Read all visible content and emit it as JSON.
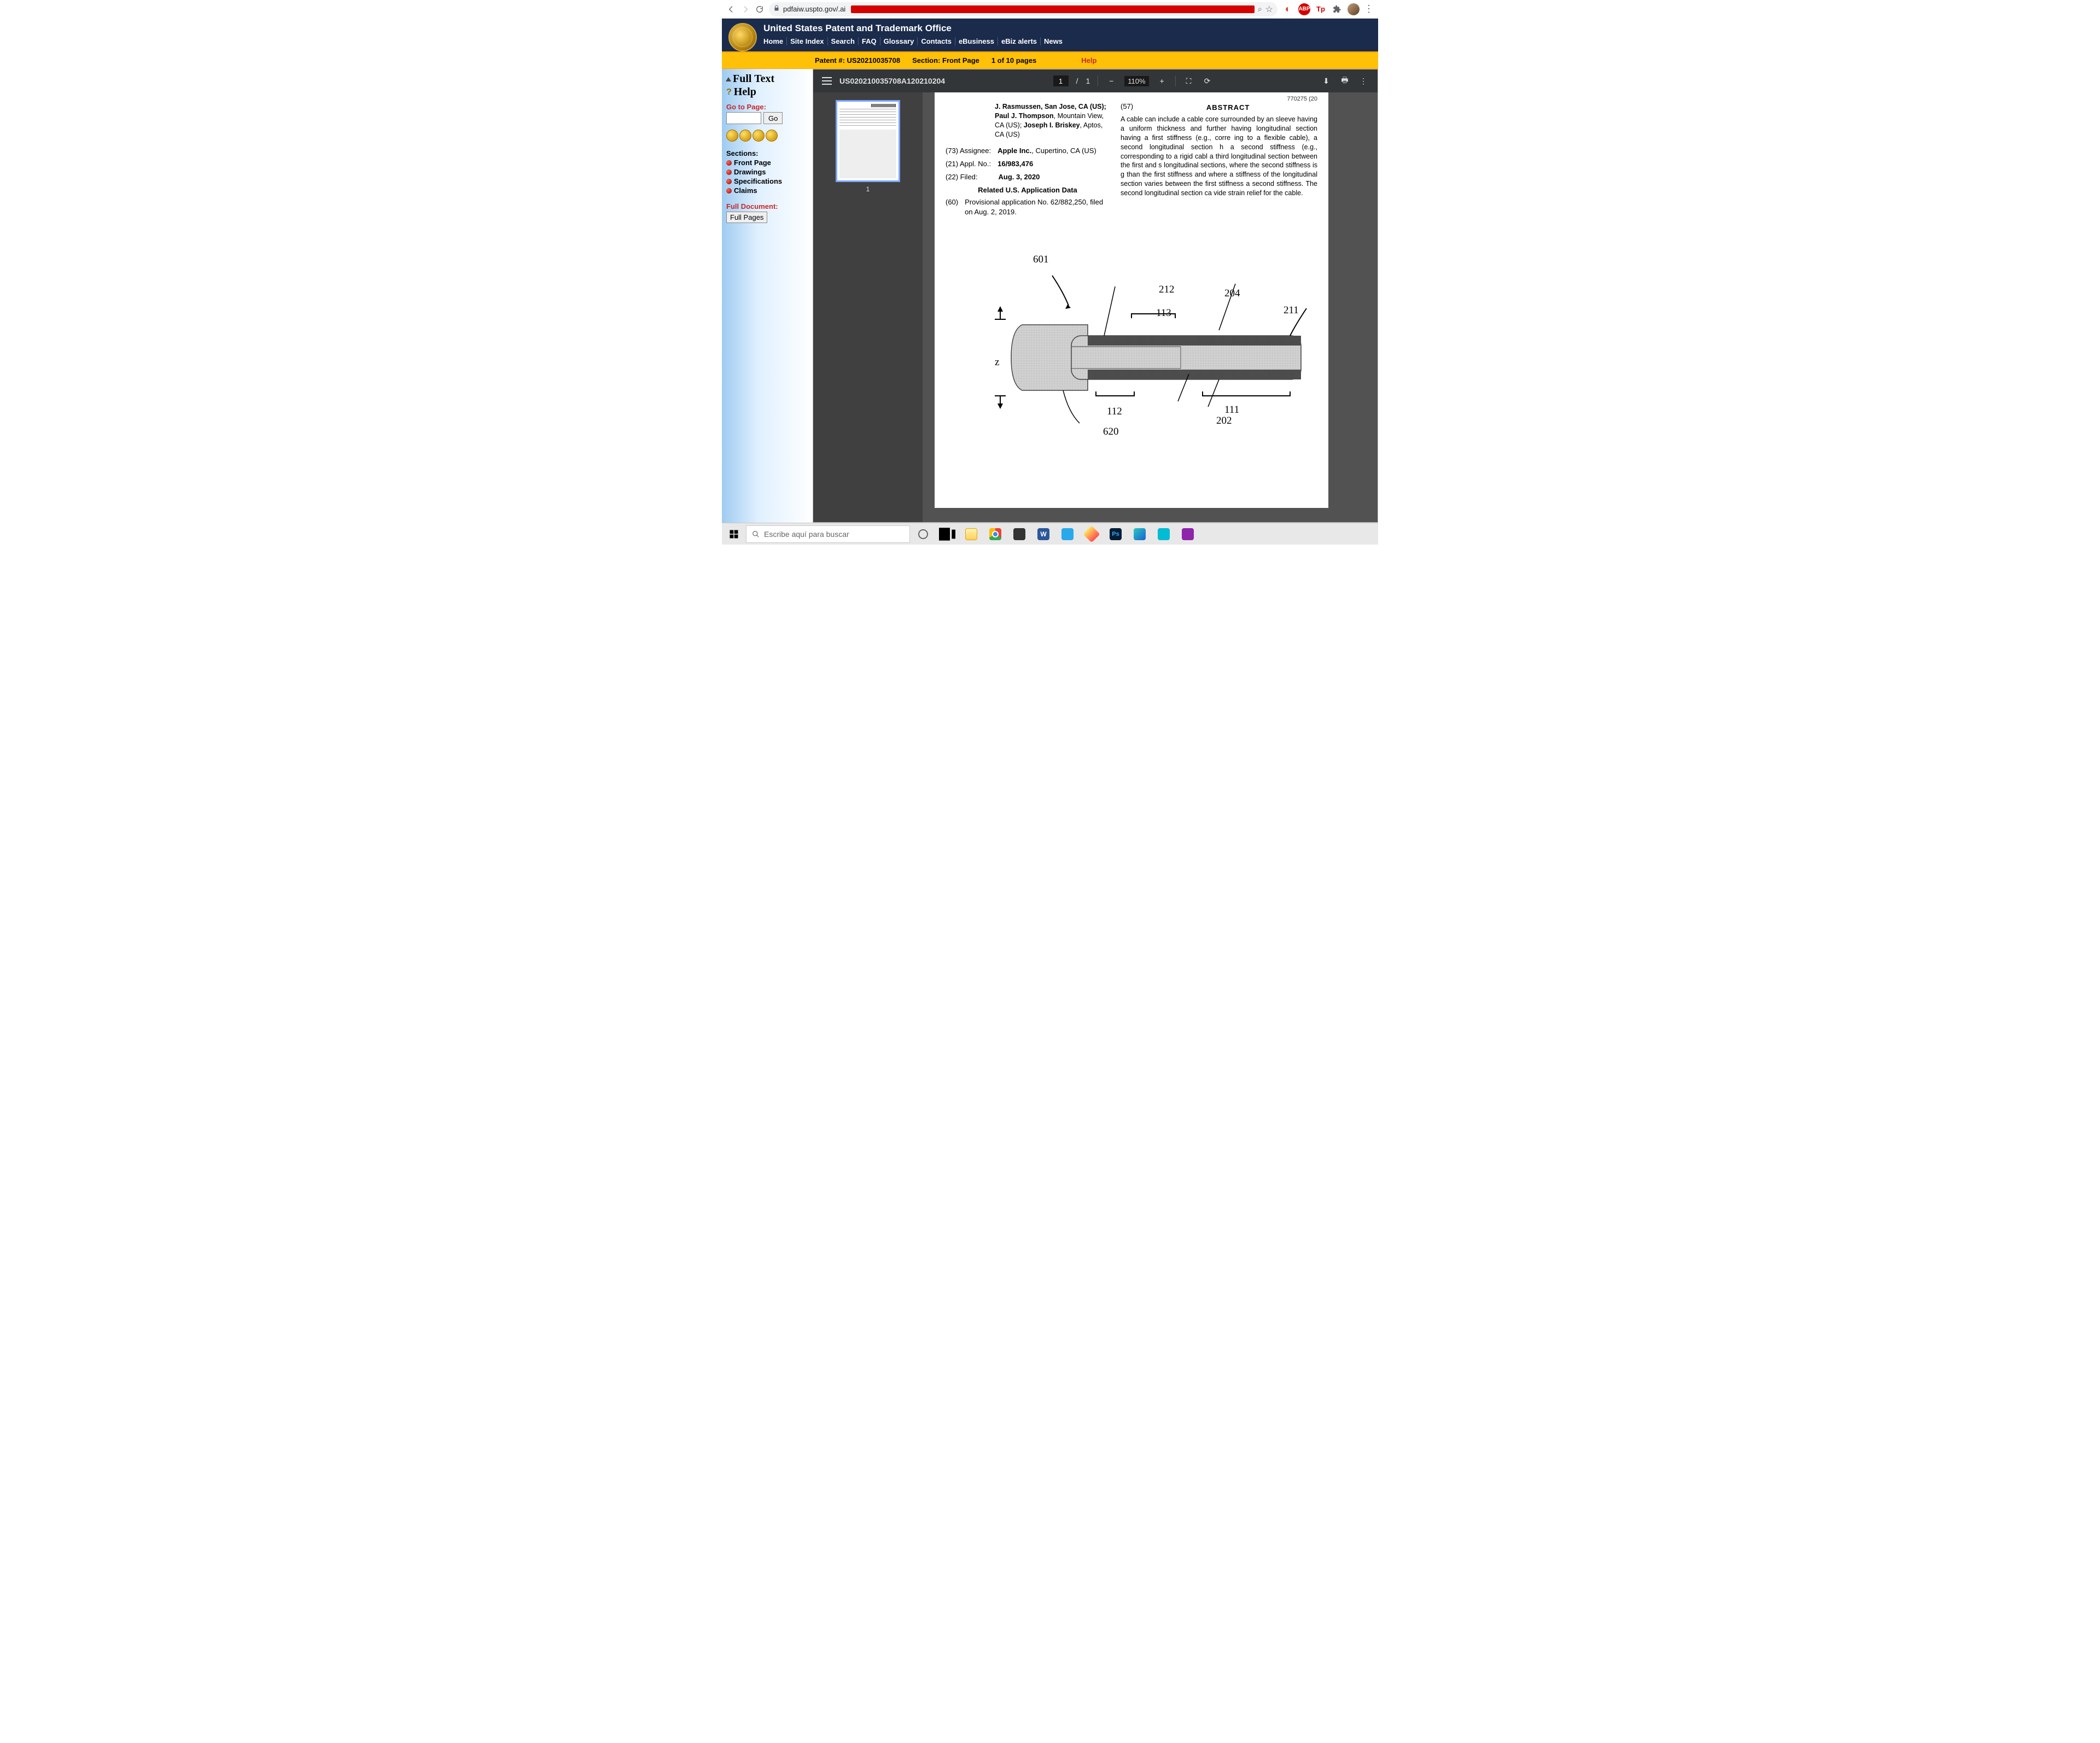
{
  "chrome": {
    "url_prefix": "pdfaiw.uspto.gov/.ai"
  },
  "uspto": {
    "title": "United States Patent and Trademark Office",
    "nav": [
      "Home",
      "Site Index",
      "Search",
      "FAQ",
      "Glossary",
      "Contacts",
      "eBusiness",
      "eBiz alerts",
      "News"
    ]
  },
  "yellow": {
    "patent": "Patent #: US20210035708",
    "section": "Section: Front Page",
    "pages": "1 of 10 pages",
    "help": "Help"
  },
  "sidebar": {
    "full_text": "Full Text",
    "help": "Help",
    "goto_label": "Go to Page:",
    "go_btn": "Go",
    "sections_label": "Sections:",
    "sections": [
      "Front Page",
      "Drawings",
      "Specifications",
      "Claims"
    ],
    "full_doc": "Full Document:",
    "full_pages": "Full Pages"
  },
  "viewer": {
    "filename": "US020210035708A120210204",
    "page_current": "1",
    "page_sep": "/",
    "page_total": "1",
    "zoom": "110%",
    "thumb_num": "1"
  },
  "patent": {
    "top_fragment": "770275 (20",
    "inventors_line1": "J. Rasmussen, San Jose, CA (US);",
    "inventors_line2": "Paul J. Thompson, Mountain View, CA (US); Joseph I. Briskey, Aptos, CA (US)",
    "assignee_label": "(73)  Assignee:",
    "assignee_val": "Apple Inc., Cupertino, CA (US)",
    "appl_label": "(21)  Appl. No.:",
    "appl_val": "16/983,476",
    "filed_label": "(22)  Filed:",
    "filed_val": "Aug. 3, 2020",
    "related_h": "Related U.S. Application Data",
    "provisional_label": "(60)",
    "provisional_text": "Provisional application No. 62/882,250, filed on Aug. 2, 2019.",
    "abs_num": "(57)",
    "abs_h": "ABSTRACT",
    "abs_body": "A cable can include a cable core surrounded by an sleeve having a uniform thickness and further having longitudinal section having a first stiffness (e.g., corre ing to a flexible cable), a second longitudinal section h a second stiffness (e.g., corresponding to a rigid cabl a third longitudinal section between the first and s longitudinal sections, where the second stiffness is g than the first stiffness and where a stiffness of the longitudinal section varies between the first stiffness a second stiffness. The second longitudinal section ca vide strain relief for the cable.",
    "fig": {
      "n601": "601",
      "n212": "212",
      "n204": "204",
      "n113": "113",
      "n211": "211",
      "n112": "112",
      "n111": "111",
      "n202": "202",
      "n620": "620",
      "z": "z"
    }
  },
  "taskbar": {
    "search_placeholder": "Escribe aquí para buscar",
    "word": "W",
    "ps": "Ps"
  }
}
